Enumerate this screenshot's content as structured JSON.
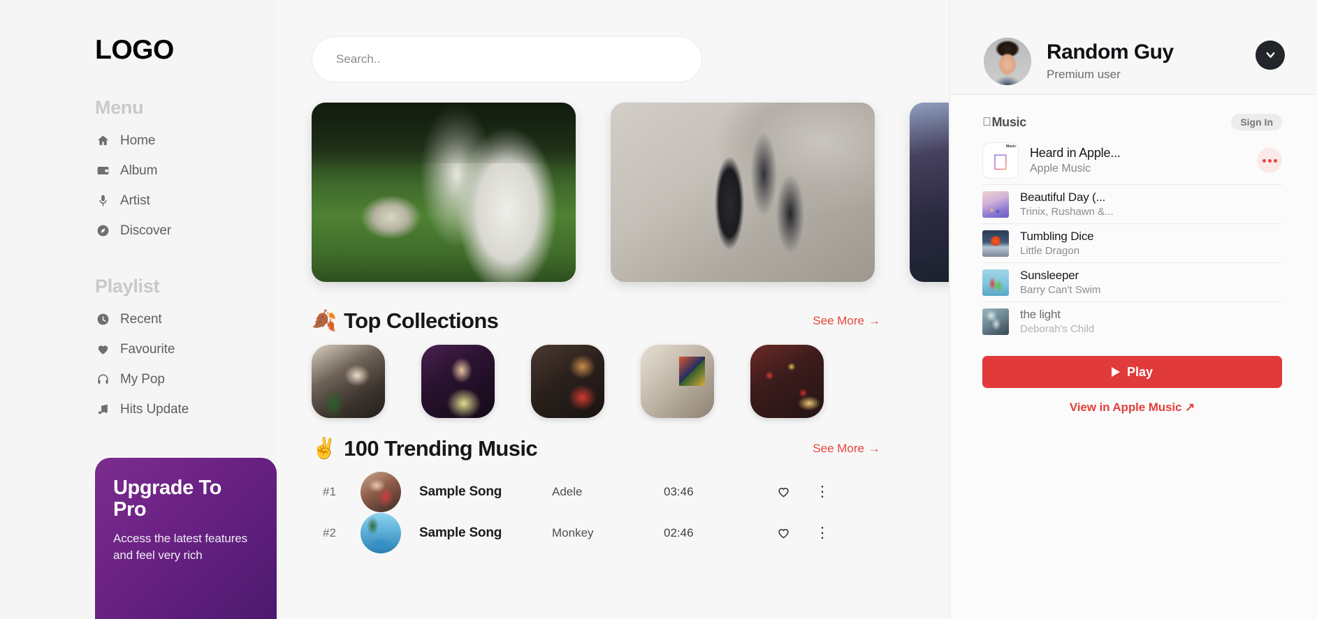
{
  "brand": {
    "logo": "LOGO"
  },
  "sidebar": {
    "menu_title": "Menu",
    "menu_items": [
      {
        "label": "Home",
        "icon": "home-icon"
      },
      {
        "label": "Album",
        "icon": "album-icon"
      },
      {
        "label": "Artist",
        "icon": "microphone-icon"
      },
      {
        "label": "Discover",
        "icon": "compass-icon"
      }
    ],
    "playlist_title": "Playlist",
    "playlist_items": [
      {
        "label": "Recent",
        "icon": "clock-icon"
      },
      {
        "label": "Favourite",
        "icon": "heart-icon"
      },
      {
        "label": "My Pop",
        "icon": "headphones-icon"
      },
      {
        "label": "Hits Update",
        "icon": "music-note-icon"
      }
    ],
    "upgrade": {
      "title": "Upgrade To Pro",
      "description": "Access the latest features and feel very rich",
      "gradient_from": "#7b2d8e",
      "gradient_to": "#4b1a6e"
    }
  },
  "search": {
    "value": "",
    "placeholder": "Search.."
  },
  "banners": [
    {
      "name": "football-banner"
    },
    {
      "name": "skatepark-banner"
    },
    {
      "name": "graffiti-banner"
    }
  ],
  "sections": {
    "collections": {
      "emoji": "🍂",
      "title": "Top Collections",
      "see_more": "See More",
      "see_more_arrow": "→",
      "accent": "#e8453c",
      "items": [
        {
          "name": "collection-cafe"
        },
        {
          "name": "collection-party"
        },
        {
          "name": "collection-friends"
        },
        {
          "name": "collection-interior"
        },
        {
          "name": "collection-food"
        }
      ]
    },
    "trending": {
      "emoji": "✌️",
      "title": "100 Trending Music",
      "see_more": "See More",
      "see_more_arrow": "→",
      "accent": "#e8453c",
      "rows": [
        {
          "rank": "#1",
          "song": "Sample Song",
          "artist": "Adele",
          "duration": "03:46"
        },
        {
          "rank": "#2",
          "song": "Sample Song",
          "artist": "Monkey",
          "duration": "02:46"
        }
      ]
    }
  },
  "profile": {
    "name": "Random Guy",
    "subtitle": "Premium user",
    "avatar_alt": "user-avatar",
    "chevron": "chevron-down-icon"
  },
  "apple_music": {
    "logo_text": "Music",
    "apple_glyph": "",
    "sign_in": "Sign In",
    "featured": {
      "title": "Heard in Apple...",
      "subtitle": "Apple Music",
      "badge": "Music",
      "more": "more-options-icon"
    },
    "tracks": [
      {
        "title": "Beautiful Day (...",
        "artist": "Trinix, Rushawn &...",
        "art": "art-bd",
        "dim": false
      },
      {
        "title": "Tumbling Dice",
        "artist": "Little Dragon",
        "art": "art-td",
        "dim": false
      },
      {
        "title": "Sunsleeper",
        "artist": "Barry Can't Swim",
        "art": "art-ss",
        "dim": false
      },
      {
        "title": "the light",
        "artist": "Deborah's Child",
        "art": "art-tl",
        "dim": true
      }
    ],
    "play_label": "Play",
    "view_label": "View in Apple Music ↗",
    "accent": "#e03a3a"
  }
}
